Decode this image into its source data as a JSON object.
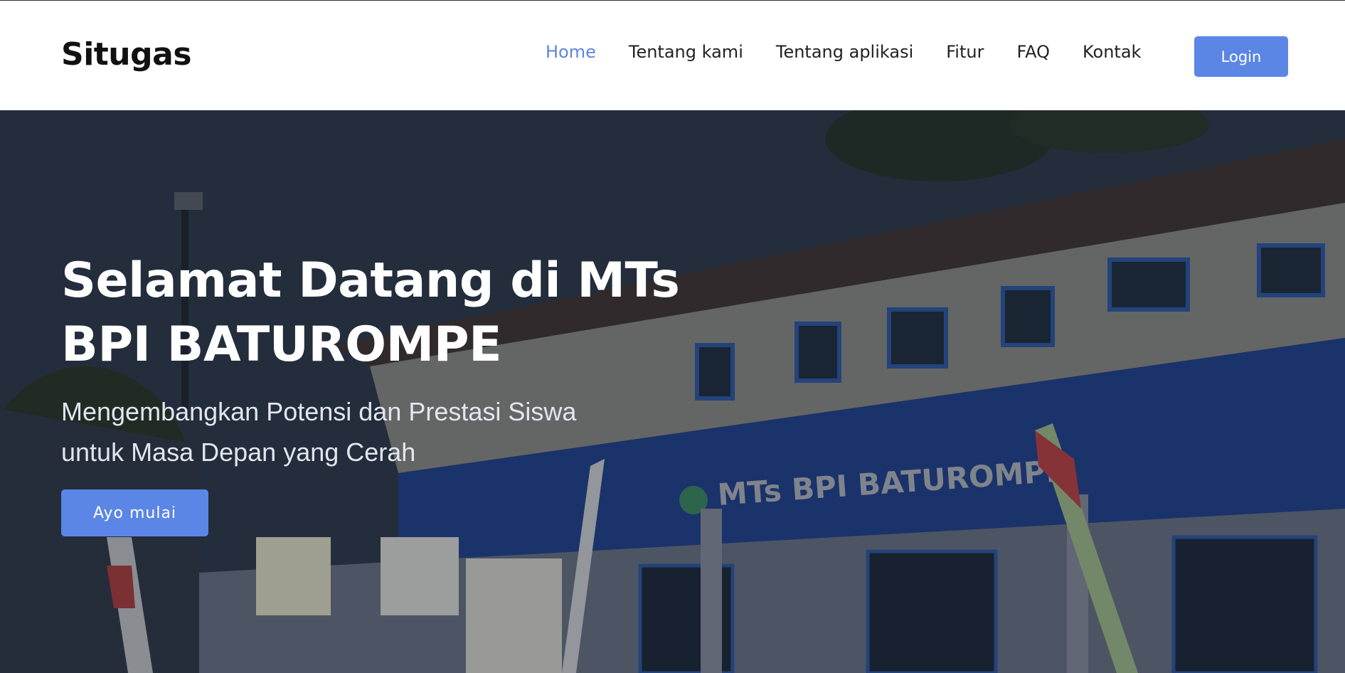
{
  "header": {
    "brand": "Situgas",
    "nav": [
      {
        "label": "Home",
        "active": true
      },
      {
        "label": "Tentang kami"
      },
      {
        "label": "Tentang aplikasi"
      },
      {
        "label": "Fitur"
      },
      {
        "label": "FAQ"
      },
      {
        "label": "Kontak"
      }
    ],
    "login_label": "Login"
  },
  "hero": {
    "title_line1": "Selamat Datang di MTs",
    "title_line2": "BPI BATUROMPE",
    "subtitle_line1": "Mengembangkan Potensi dan Prestasi Siswa",
    "subtitle_line2": "untuk Masa Depan yang Cerah",
    "cta_label": "Ayo mulai",
    "building_sign": "MTs BPI BATUROMPE"
  },
  "colors": {
    "accent": "#5b86e5",
    "nav_text": "#222222",
    "brand_text": "#111111"
  }
}
